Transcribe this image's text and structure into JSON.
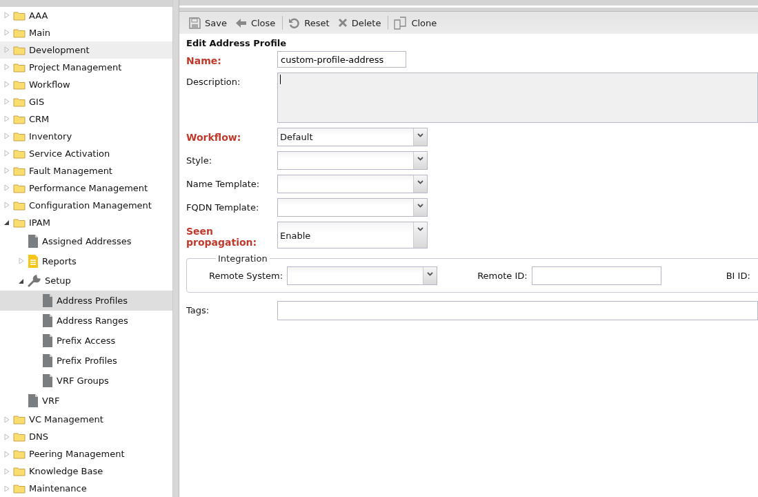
{
  "tree": [
    {
      "label": "AAA",
      "kind": "folder",
      "expanded": false,
      "selected": false,
      "hover": false
    },
    {
      "label": "Main",
      "kind": "folder",
      "expanded": false,
      "selected": false,
      "hover": false
    },
    {
      "label": "Development",
      "kind": "folder",
      "expanded": false,
      "selected": false,
      "hover": true
    },
    {
      "label": "Project Management",
      "kind": "folder",
      "expanded": false,
      "selected": false,
      "hover": false
    },
    {
      "label": "Workflow",
      "kind": "folder",
      "expanded": false,
      "selected": false,
      "hover": false
    },
    {
      "label": "GIS",
      "kind": "folder",
      "expanded": false,
      "selected": false,
      "hover": false
    },
    {
      "label": "CRM",
      "kind": "folder",
      "expanded": false,
      "selected": false,
      "hover": false
    },
    {
      "label": "Inventory",
      "kind": "folder",
      "expanded": false,
      "selected": false,
      "hover": false
    },
    {
      "label": "Service Activation",
      "kind": "folder",
      "expanded": false,
      "selected": false,
      "hover": false
    },
    {
      "label": "Fault Management",
      "kind": "folder",
      "expanded": false,
      "selected": false,
      "hover": false
    },
    {
      "label": "Performance Management",
      "kind": "folder",
      "expanded": false,
      "selected": false,
      "hover": false
    },
    {
      "label": "Configuration Management",
      "kind": "folder",
      "expanded": false,
      "selected": false,
      "hover": false
    },
    {
      "label": "IPAM",
      "kind": "folder",
      "expanded": true,
      "selected": false,
      "hover": false,
      "children": [
        {
          "label": "Assigned Addresses",
          "kind": "doc",
          "selected": false,
          "hover": false
        },
        {
          "label": "Reports",
          "kind": "report",
          "expanded": false,
          "selected": false,
          "hover": false
        },
        {
          "label": "Setup",
          "kind": "wrench",
          "expanded": true,
          "selected": false,
          "hover": false,
          "children": [
            {
              "label": "Address Profiles",
              "kind": "doc",
              "selected": true,
              "hover": false
            },
            {
              "label": "Address Ranges",
              "kind": "doc",
              "selected": false,
              "hover": false
            },
            {
              "label": "Prefix Access",
              "kind": "doc",
              "selected": false,
              "hover": false
            },
            {
              "label": "Prefix Profiles",
              "kind": "doc",
              "selected": false,
              "hover": false
            },
            {
              "label": "VRF Groups",
              "kind": "doc",
              "selected": false,
              "hover": false
            }
          ]
        },
        {
          "label": "VRF",
          "kind": "doc",
          "selected": false,
          "hover": false
        }
      ]
    },
    {
      "label": "VC Management",
      "kind": "folder",
      "expanded": false,
      "selected": false,
      "hover": false
    },
    {
      "label": "DNS",
      "kind": "folder",
      "expanded": false,
      "selected": false,
      "hover": false
    },
    {
      "label": "Peering Management",
      "kind": "folder",
      "expanded": false,
      "selected": false,
      "hover": false
    },
    {
      "label": "Knowledge Base",
      "kind": "folder",
      "expanded": false,
      "selected": false,
      "hover": false
    },
    {
      "label": "Maintenance",
      "kind": "folder",
      "expanded": false,
      "selected": false,
      "hover": false
    }
  ],
  "toolbar": [
    {
      "label": "Save",
      "kind": "save"
    },
    {
      "label": "Close",
      "kind": "back"
    },
    {
      "kind": "separator"
    },
    {
      "label": "Reset",
      "kind": "reset"
    },
    {
      "label": "Delete",
      "kind": "delete"
    },
    {
      "kind": "separator"
    },
    {
      "label": "Clone",
      "kind": "clone"
    }
  ],
  "form": {
    "title": "Edit Address Profile",
    "fields": [
      {
        "label": "Name:",
        "kind": "text",
        "required": true,
        "value": "custom-profile-address"
      },
      {
        "label": "Description:",
        "kind": "textarea",
        "required": false
      },
      {
        "label": "Workflow:",
        "kind": "select",
        "required": true,
        "value": "Default"
      },
      {
        "label": "Style:",
        "kind": "select",
        "required": false
      },
      {
        "label": "Name Template:",
        "kind": "select",
        "required": false
      },
      {
        "label": "FQDN Template:",
        "kind": "select",
        "required": false
      },
      {
        "label": "Seen propagation:",
        "kind": "select",
        "required": true,
        "value": "Enable"
      }
    ],
    "integration": {
      "legend": "Integration",
      "fields": [
        {
          "label": "Remote System:",
          "kind": "select"
        },
        {
          "label": "Remote ID:",
          "kind": "text"
        },
        {
          "label": "BI ID:",
          "kind": "cut"
        }
      ]
    },
    "tags": {
      "label": "Tags:"
    }
  }
}
